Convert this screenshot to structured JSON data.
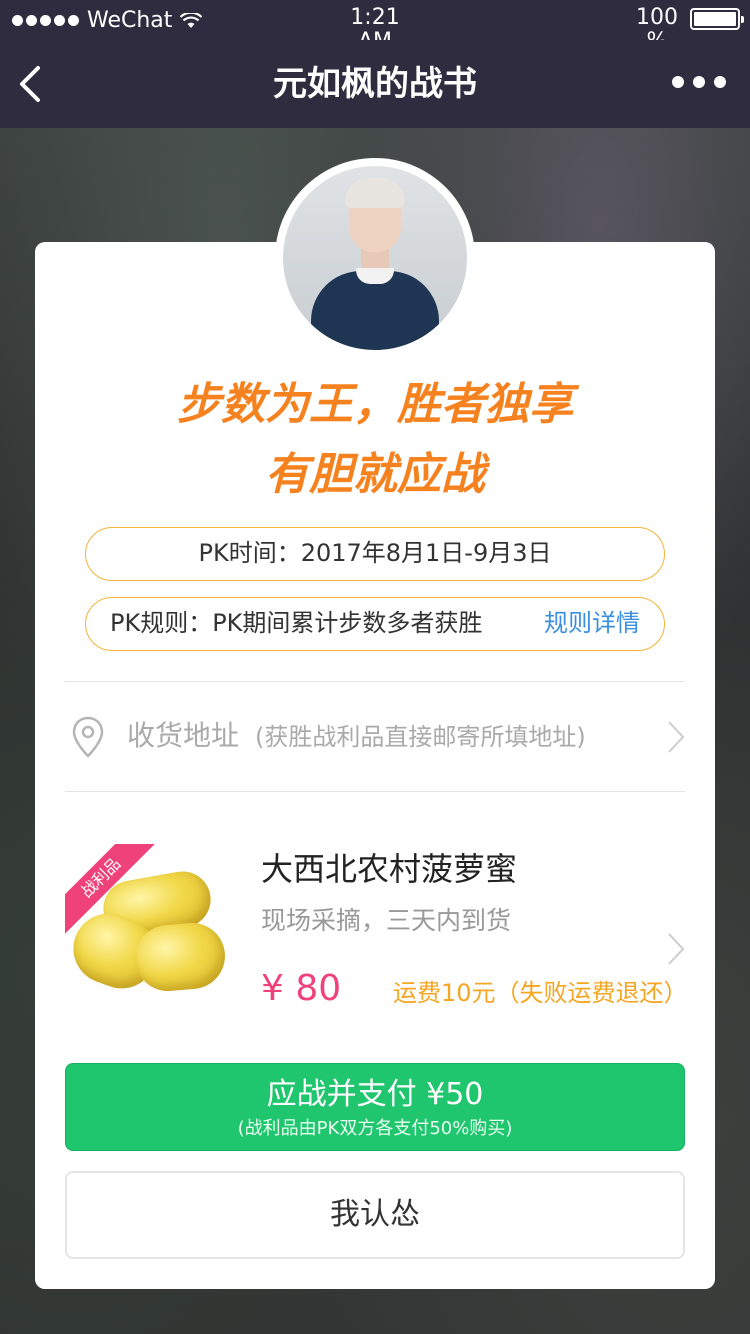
{
  "status_bar": {
    "carrier": "WeChat",
    "time": "1:21\nAM",
    "battery": "100\n%"
  },
  "nav": {
    "title": "元如枫的战书"
  },
  "challenge": {
    "headline_line1": "步数为王，胜者独享",
    "headline_line2": "有胆就应战",
    "pk_time": "PK时间：2017年8月1日-9月3日",
    "pk_rule": "PK规则：PK期间累计步数多者获胜",
    "rule_link": "规则详情"
  },
  "address": {
    "label": "收货地址",
    "hint": "(获胜战利品直接邮寄所填地址)"
  },
  "prize": {
    "badge": "战利品",
    "name": "大西北农村菠萝蜜",
    "desc": "现场采摘，三天内到货",
    "price": "¥ 80",
    "shipping": "运费10元（失败运费退还）"
  },
  "buttons": {
    "accept_label": "应战并支付 ¥50",
    "accept_sub": "(战利品由PK双方各支付50%购买)",
    "decline_label": "我认怂"
  },
  "colors": {
    "nav_bg": "#2e2c3e",
    "headline": "#f5821f",
    "accept_green": "#1fc66e",
    "price_pink": "#f0427a",
    "link_blue": "#3a8fe0"
  }
}
